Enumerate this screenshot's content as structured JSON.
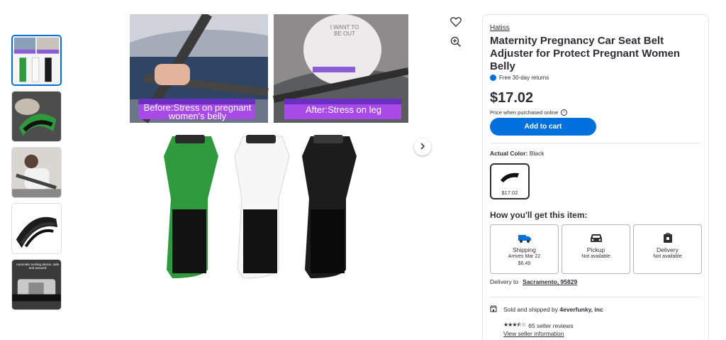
{
  "gallery": {
    "caption_before": "Before:Stress on pregnant women's belly",
    "caption_after": "After:Stress on leg",
    "thumb_5_caption": "Automatic locking device, safe and assured",
    "belly_text": "I WANT TO BE OUT"
  },
  "product": {
    "brand": "Hatiss",
    "title": "Maternity Pregnancy Car Seat Belt Adjuster for Protect Pregnant Women Belly",
    "returns": "Free 30-day returns",
    "price": "$17.02",
    "price_note": "Price when purchased online",
    "add_to_cart": "Add to cart",
    "color_label": "Actual Color:",
    "color_value": "Black",
    "swatch_price": "$17.02"
  },
  "fulfillment": {
    "heading": "How you'll get this item:",
    "options": [
      {
        "title": "Shipping",
        "line1": "Arrives Mar 22",
        "line2": "$6.49",
        "icon": "truck-icon"
      },
      {
        "title": "Pickup",
        "line1": "Not available",
        "line2": "",
        "icon": "car-icon"
      },
      {
        "title": "Delivery",
        "line1": "Not available",
        "line2": "",
        "icon": "bag-icon"
      }
    ],
    "delivery_label": "Delivery to",
    "delivery_location": "Sacramento, 95829"
  },
  "seller": {
    "sold_prefix": "Sold and shipped by",
    "seller_name": "4everfunky, inc",
    "rating": 3.5,
    "reviews": "65 seller reviews",
    "view_info": "View seller information"
  },
  "colors": {
    "accent": "#0071dc",
    "text": "#2e2f32",
    "green": "#2e9a3c",
    "purple": "#9b3fe0"
  }
}
